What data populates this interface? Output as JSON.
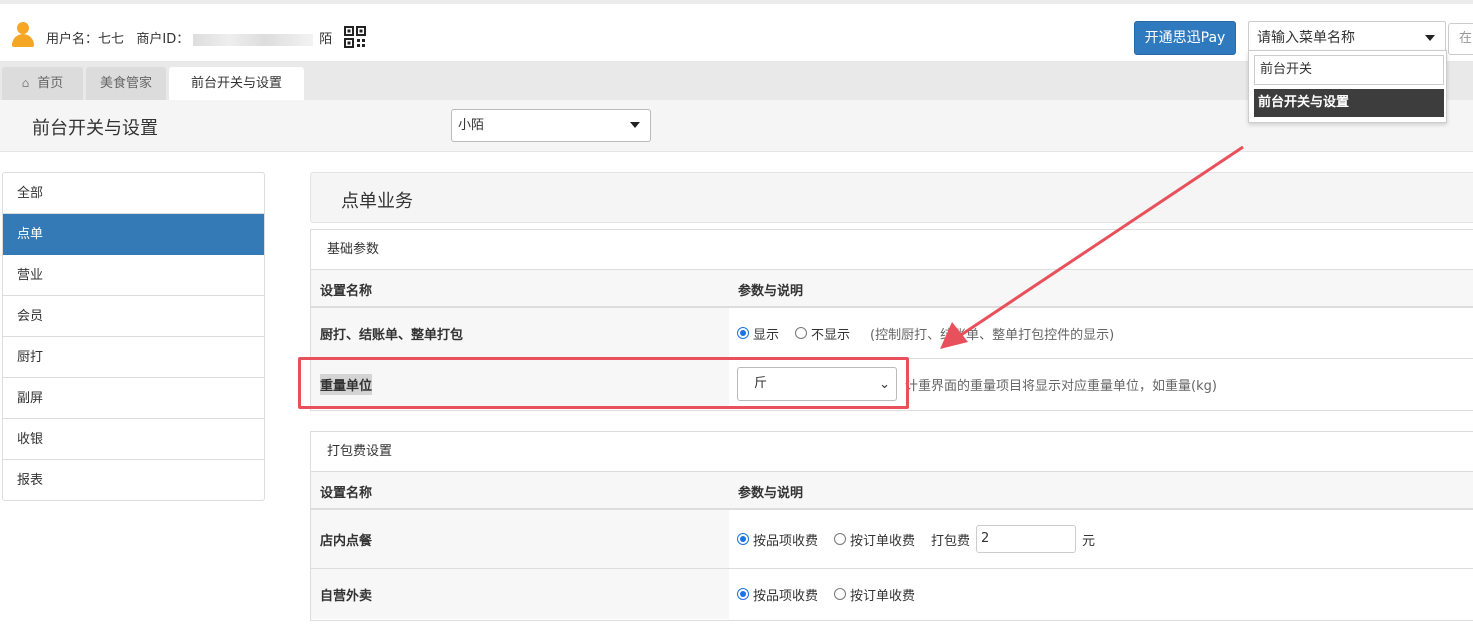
{
  "header": {
    "user_label": "用户名：七七",
    "merchant_label": "商户ID：",
    "merchant_suffix": "陌",
    "pay_button": "开通思迅Pay",
    "menu_search_placeholder": "请输入菜单名称",
    "right_input_placeholder": "在",
    "dropdown": {
      "filter_value": "前台开关",
      "option": "前台开关与设置"
    }
  },
  "tabs": [
    {
      "label": "首页"
    },
    {
      "label": "美食管家"
    },
    {
      "label": "前台开关与设置"
    }
  ],
  "page": {
    "title": "前台开关与设置",
    "store_select": "小陌"
  },
  "sidebar": {
    "items": [
      {
        "label": "全部"
      },
      {
        "label": "点单"
      },
      {
        "label": "营业"
      },
      {
        "label": "会员"
      },
      {
        "label": "厨打"
      },
      {
        "label": "副屏"
      },
      {
        "label": "收银"
      },
      {
        "label": "报表"
      }
    ]
  },
  "section": {
    "title": "点单业务",
    "panels": [
      {
        "title": "基础参数",
        "col_name": "设置名称",
        "col_param": "参数与说明",
        "rows": [
          {
            "name": "厨打、结账单、整单打包",
            "opt1": "显示",
            "opt2": "不显示",
            "note": "(控制厨打、结账单、整单打包控件的显示)"
          },
          {
            "name": "重量单位",
            "select_value": "斤",
            "note": "计重界面的重量项目将显示对应重量单位，如重量(kg)"
          }
        ]
      },
      {
        "title": "打包费设置",
        "col_name": "设置名称",
        "col_param": "参数与说明",
        "rows": [
          {
            "name": "店内点餐",
            "opt1": "按品项收费",
            "opt2": "按订单收费",
            "fee_label": "打包费",
            "fee_value": "2",
            "fee_unit": "元"
          },
          {
            "name": "自营外卖",
            "opt1": "按品项收费",
            "opt2": "按订单收费"
          }
        ]
      }
    ]
  },
  "colors": {
    "primary": "#337ab7",
    "annotation": "#e8505b",
    "avatar": "#f5a623"
  }
}
